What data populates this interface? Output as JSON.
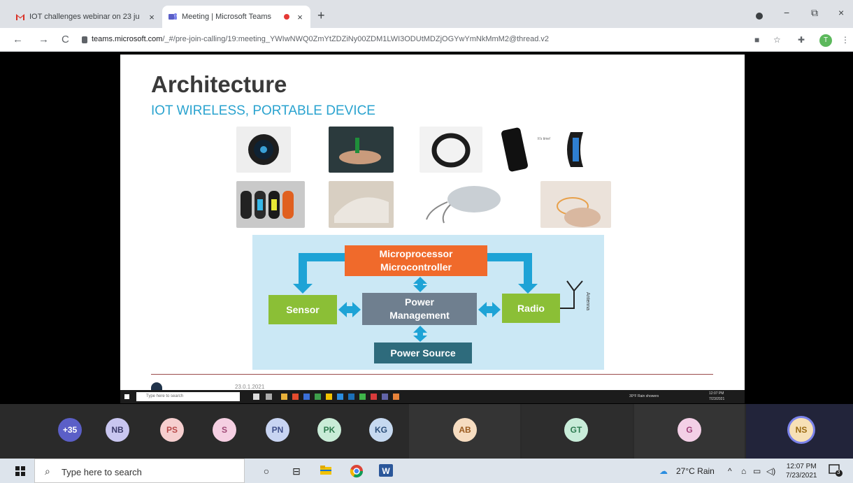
{
  "browser": {
    "tabs": [
      {
        "title": "IOT challenges webinar on 23 ju",
        "favicon": "gmail-icon",
        "active": false
      },
      {
        "title": "Meeting | Microsoft Teams",
        "favicon": "teams-icon",
        "active": true,
        "recording": true
      }
    ],
    "tab_close": "×",
    "new_tab": "+",
    "window_controls": {
      "minimize": "−",
      "restore": "⧉",
      "close": "×"
    },
    "nav": {
      "back": "←",
      "forward": "→",
      "reload": "C"
    },
    "url_host": "teams.microsoft.com",
    "url_path": "/_#/pre-join-calling/19:meeting_YWIwNWQ0ZmYtZDZiNy00ZDM1LWI3ODUtMDZjOGYwYmNkMmM2@thread.v2",
    "profile_initial": "T",
    "menu": "⋮"
  },
  "slide": {
    "title": "Architecture",
    "subtitle": "IOT WIRELESS, PORTABLE DEVICE",
    "caption_watch": "It's time!",
    "diagram": {
      "microprocessor_line1": "Microprocessor",
      "microprocessor_line2": "Microcontroller",
      "sensor": "Sensor",
      "power_line1": "Power",
      "power_line2": "Management",
      "radio": "Radio",
      "power_source": "Power Source",
      "antenna": "Antenna"
    },
    "footer_date": "23.0.1.2021"
  },
  "shared_screen_taskbar": {
    "search_placeholder": "Type here to search",
    "tray_text": "30°F Rain showers",
    "clock_time": "12:07 PM",
    "clock_date": "7/23/2021"
  },
  "participants": [
    {
      "initials": "+35",
      "bg": "#5b5fc7",
      "fg": "#ffffff"
    },
    {
      "initials": "NB",
      "bg": "#c9c6f0",
      "fg": "#3b3a6a"
    },
    {
      "initials": "PS",
      "bg": "#f6cfcf",
      "fg": "#b84a4a"
    },
    {
      "initials": "S",
      "bg": "#f5cfe2",
      "fg": "#a04a77"
    },
    {
      "initials": "PN",
      "bg": "#c8d4f2",
      "fg": "#3f4f8a"
    },
    {
      "initials": "PK",
      "bg": "#c9ecd7",
      "fg": "#2d7a4d"
    },
    {
      "initials": "KG",
      "bg": "#c6d9f0",
      "fg": "#2c4f7a"
    },
    {
      "initials": "AB",
      "bg": "#f6dcc0",
      "fg": "#9a5a1e"
    },
    {
      "initials": "GT",
      "bg": "#c8ecd9",
      "fg": "#2d7a50"
    },
    {
      "initials": "G",
      "bg": "#f3cfe6",
      "fg": "#a0427a"
    },
    {
      "initials": "NS",
      "bg": "#f7e0b6",
      "fg": "#9a6a12"
    }
  ],
  "taskbar": {
    "search_placeholder": "Type here to search",
    "weather": "27°C  Rain",
    "clock_time": "12:07 PM",
    "clock_date": "7/23/2021",
    "notification_count": "3"
  },
  "colors": {
    "accent_teams": "#5b5fc7",
    "slide_subtitle": "#2aa3cf",
    "block_orange": "#f06a2b",
    "block_green": "#8bbf36",
    "block_gray": "#6f7f8f",
    "block_teal": "#2e6b7c",
    "arrow_blue": "#1ea3d6"
  }
}
